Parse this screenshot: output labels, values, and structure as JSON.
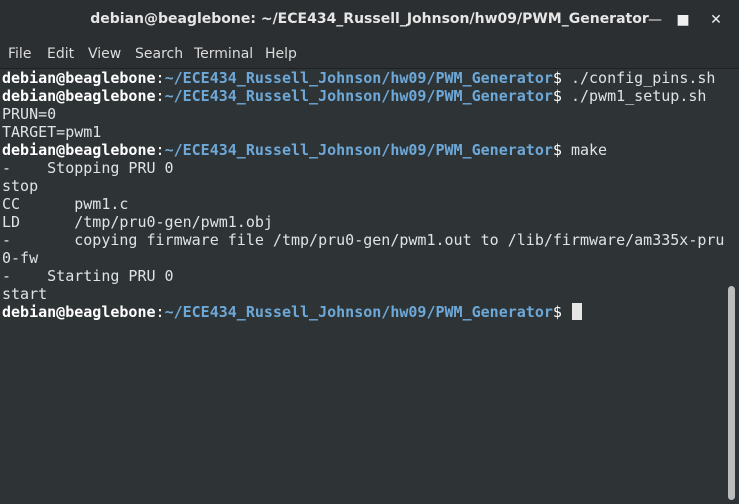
{
  "window": {
    "title": "debian@beaglebone: ~/ECE434_Russell_Johnson/hw09/PWM_Generator",
    "min_icon": "minimize-icon",
    "max_icon": "maximize-icon",
    "close_icon": "close-icon"
  },
  "menu": [
    "File",
    "Edit",
    "View",
    "Search",
    "Terminal",
    "Help"
  ],
  "prompt": {
    "user": "debian@beaglebone",
    "path": "~/ECE434_Russell_Johnson/hw09/PWM_Generator"
  },
  "terminal": {
    "lines": [
      {
        "type": "prompt",
        "cmd": "./config_pins.sh"
      },
      {
        "type": "prompt",
        "cmd": "./pwm1_setup.sh"
      },
      {
        "type": "text",
        "text": "PRUN=0"
      },
      {
        "type": "text",
        "text": "TARGET=pwm1"
      },
      {
        "type": "prompt",
        "cmd": "make"
      },
      {
        "type": "text",
        "text": "-    Stopping PRU 0"
      },
      {
        "type": "text",
        "text": "stop"
      },
      {
        "type": "text",
        "text": "CC      pwm1.c"
      },
      {
        "type": "text",
        "text": "LD      /tmp/pru0-gen/pwm1.obj"
      },
      {
        "type": "text",
        "text": "-       copying firmware file /tmp/pru0-gen/pwm1.out to /lib/firmware/am335x-pru"
      },
      {
        "type": "text",
        "text": "0-fw"
      },
      {
        "type": "text",
        "text": "-    Starting PRU 0"
      },
      {
        "type": "text",
        "text": "start"
      },
      {
        "type": "prompt",
        "cmd": ""
      }
    ]
  },
  "colors": {
    "background": "#2e3436",
    "prompt_path": "#6ea8d8",
    "titlebar": "#2b2f31"
  }
}
